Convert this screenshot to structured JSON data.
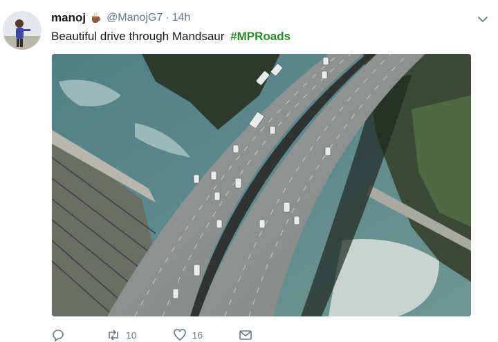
{
  "tweet": {
    "author_name": "manoj",
    "author_handle": "@ManojG7",
    "separator": "·",
    "time": "14h",
    "text": "Beautiful drive through Mandsaur",
    "hashtag": "#MPRoads",
    "actions": {
      "reply_count": "",
      "retweet_count": "10",
      "like_count": "16"
    }
  },
  "colors": {
    "hashtag": "#2a8a2a",
    "secondary_text": "#657786",
    "primary_text": "#14171a"
  },
  "icons": [
    "chevron-down-icon",
    "reply-icon",
    "retweet-icon",
    "like-icon",
    "message-icon",
    "coffee-emoji-icon"
  ]
}
